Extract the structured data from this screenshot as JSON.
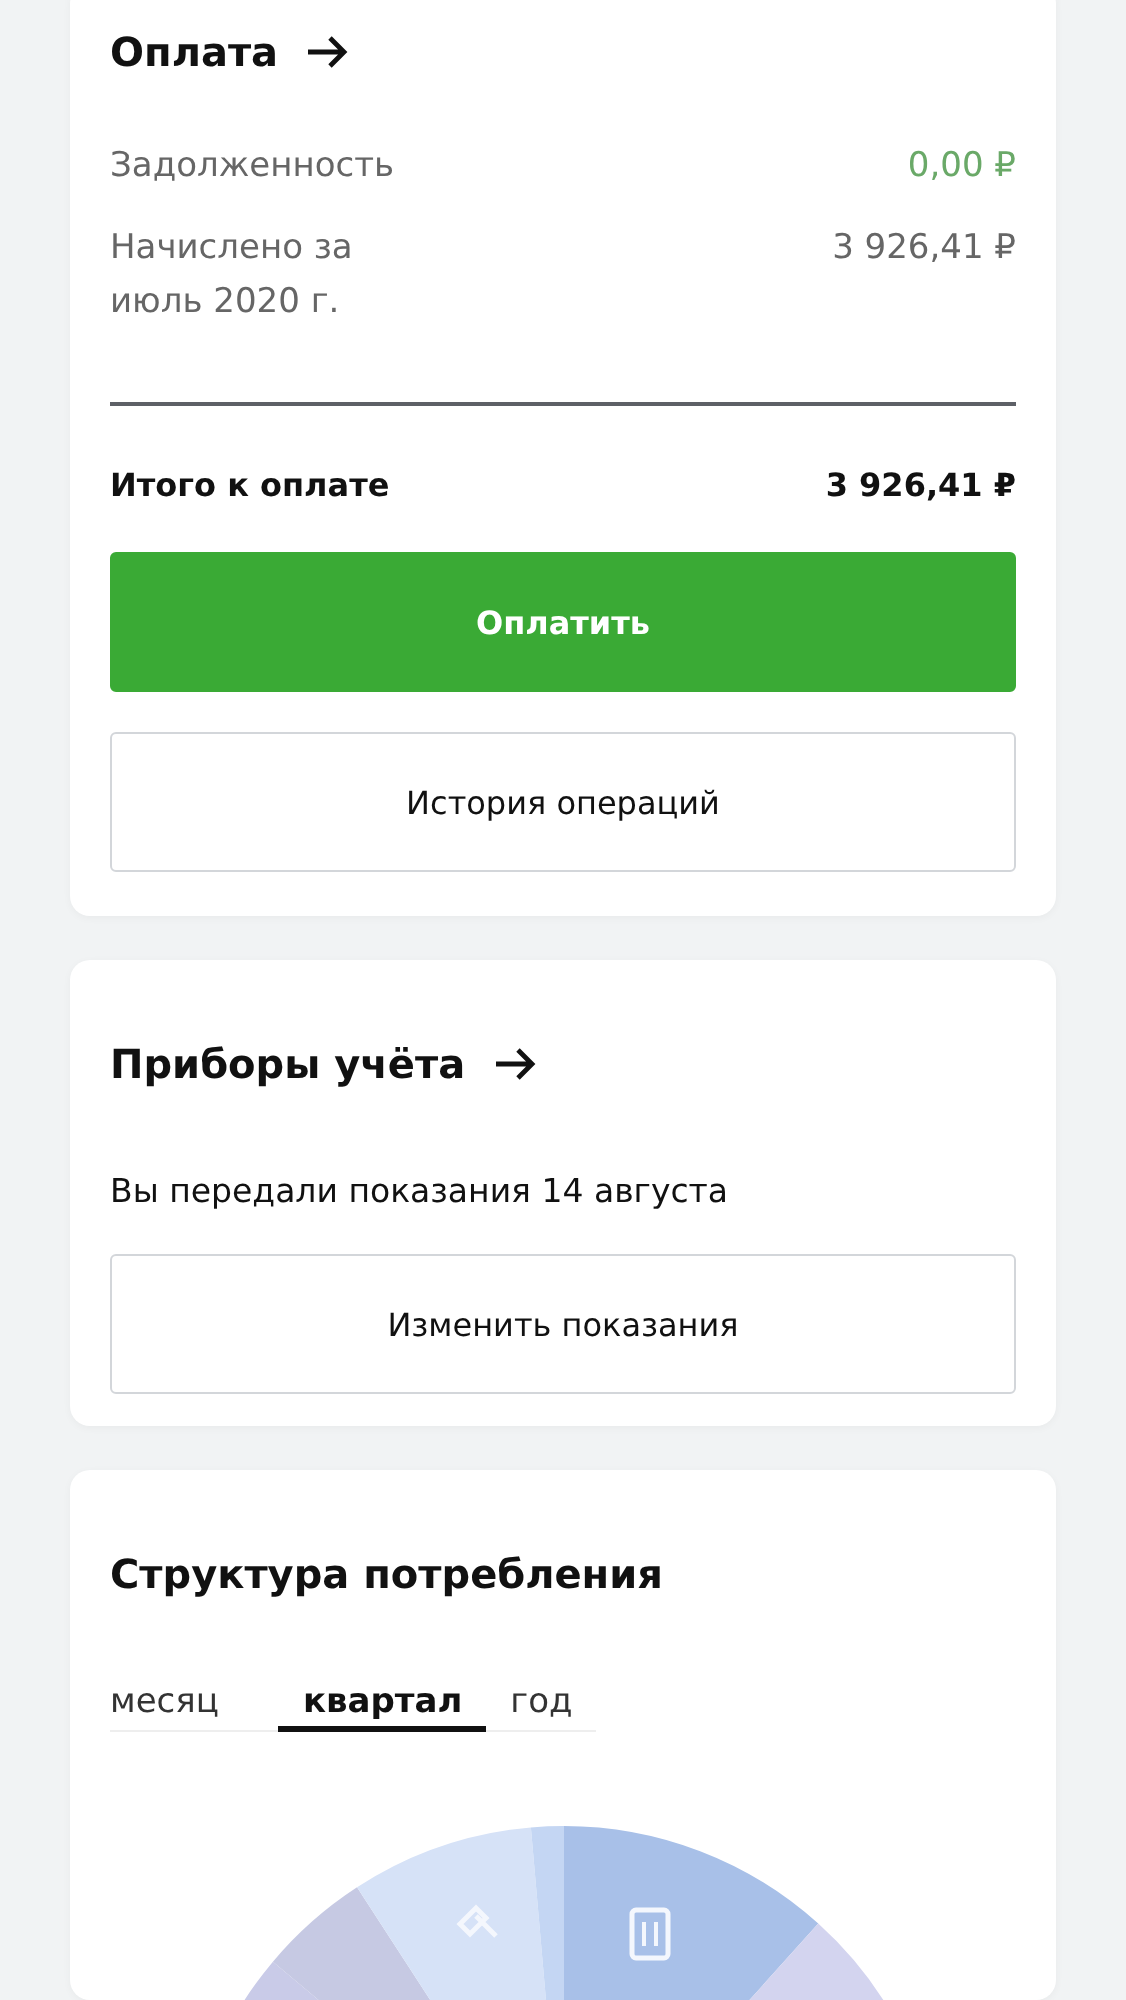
{
  "payment": {
    "title": "Оплата",
    "rows": [
      {
        "label": "Задолженность",
        "amount": "0,00 ₽",
        "color": "#6aa968"
      },
      {
        "label": "Начислено за июль 2020 г.",
        "amount": "3 926,41 ₽",
        "color": "#666666"
      }
    ],
    "total": {
      "label": "Итого к оплате",
      "amount": "3 926,41 ₽"
    },
    "buttons": [
      {
        "label": "Оплатить",
        "kind": "primary"
      },
      {
        "label": "История операций",
        "kind": "secondary"
      }
    ]
  },
  "meters": {
    "title": "Приборы учёта",
    "note": "Вы передали показания 14 августа",
    "button": "Изменить показания"
  },
  "consumption": {
    "title": "Структура потребления",
    "tabs": [
      {
        "label": "месяц",
        "selected": false
      },
      {
        "label": "квартал",
        "selected": true
      },
      {
        "label": "год",
        "selected": false
      }
    ]
  }
}
